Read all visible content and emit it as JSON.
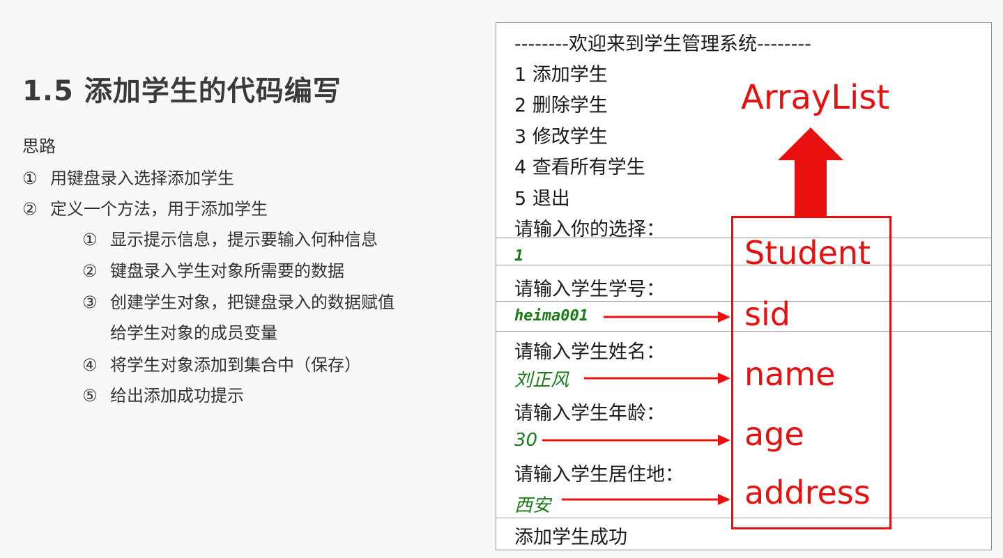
{
  "slide": {
    "title": "1.5 添加学生的代码编写",
    "subtitle": "思路",
    "steps": [
      {
        "num": "①",
        "text": "用键盘录入选择添加学生"
      },
      {
        "num": "②",
        "text": "定义一个方法，用于添加学生"
      }
    ],
    "substeps": [
      {
        "num": "①",
        "text": "显示提示信息，提示要输入何种信息"
      },
      {
        "num": "②",
        "text": "键盘录入学生对象所需要的数据"
      },
      {
        "num": "③",
        "text": "创建学生对象，把键盘录入的数据赋值"
      },
      {
        "num": "",
        "text": "给学生对象的成员变量"
      },
      {
        "num": "④",
        "text": "将学生对象添加到集合中（保存）"
      },
      {
        "num": "⑤",
        "text": "给出添加成功提示"
      }
    ]
  },
  "console": {
    "header": "--------欢迎来到学生管理系统--------",
    "menu": [
      "1 添加学生",
      "2 删除学生",
      "3 修改学生",
      "4 查看所有学生",
      "5 退出"
    ],
    "prompt_choice": "请输入你的选择：",
    "input_choice": "1",
    "prompt_sid": "请输入学生学号：",
    "input_sid": "heima001",
    "prompt_name": "请输入学生姓名：",
    "input_name": "刘正风",
    "prompt_age": "请输入学生年龄：",
    "input_age": "30",
    "prompt_address": "请输入学生居住地：",
    "input_address": "西安",
    "success": "添加学生成功"
  },
  "annotation": {
    "collection": "ArrayList",
    "class_name": "Student",
    "fields": [
      "sid",
      "name",
      "age",
      "address"
    ],
    "color": "#e8100f"
  }
}
